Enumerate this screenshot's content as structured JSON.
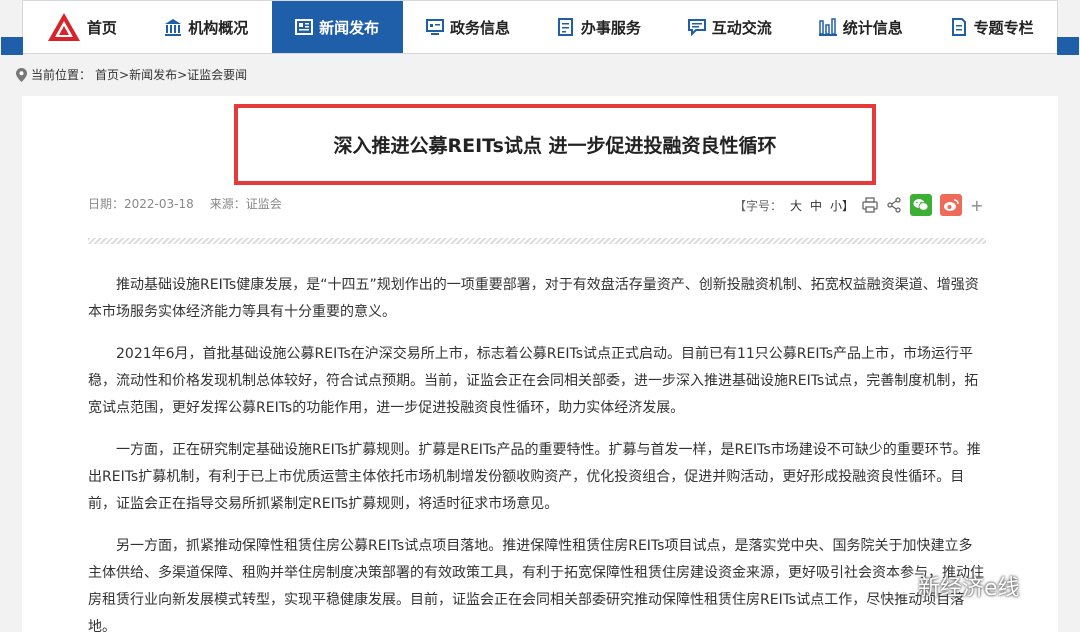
{
  "nav": {
    "items": [
      {
        "label": "首页",
        "icon": "csrc-logo-icon"
      },
      {
        "label": "机构概况",
        "icon": "building-icon"
      },
      {
        "label": "新闻发布",
        "icon": "news-icon",
        "active": true
      },
      {
        "label": "政务信息",
        "icon": "monitor-icon"
      },
      {
        "label": "办事服务",
        "icon": "document-icon"
      },
      {
        "label": "互动交流",
        "icon": "chat-icon"
      },
      {
        "label": "统计信息",
        "icon": "bar-chart-icon"
      },
      {
        "label": "专题专栏",
        "icon": "file-icon"
      }
    ],
    "accent": "#1f5ea8"
  },
  "breadcrumb": {
    "prefix": "当前位置：",
    "path": "首页>新闻发布>证监会要闻"
  },
  "article": {
    "title": "深入推进公募REITs试点 进一步促进投融资良性循环",
    "date": "日期：2022-03-18",
    "source": "来源：证监会",
    "font_size_label": "【字号：",
    "font_large": "大",
    "font_medium": "中",
    "font_small": "小】",
    "paragraphs": [
      "推动基础设施REITs健康发展，是“十四五”规划作出的一项重要部署，对于有效盘活存量资产、创新投融资机制、拓宽权益融资渠道、增强资本市场服务实体经济能力等具有十分重要的意义。",
      "2021年6月，首批基础设施公募REITs在沪深交易所上市，标志着公募REITs试点正式启动。目前已有11只公募REITs产品上市，市场运行平稳，流动性和价格发现机制总体较好，符合试点预期。当前，证监会正在会同相关部委，进一步深入推进基础设施REITs试点，完善制度机制，拓宽试点范围，更好发挥公募REITs的功能作用，进一步促进投融资良性循环，助力实体经济发展。",
      "一方面，正在研究制定基础设施REITs扩募规则。扩募是REITs产品的重要特性。扩募与首发一样，是REITs市场建设不可缺少的重要环节。推出REITs扩募机制，有利于已上市优质运营主体依托市场机制增发份额收购资产，优化投资组合，促进并购活动，更好形成投融资良性循环。目前，证监会正在指导交易所抓紧制定REITs扩募规则，将适时征求市场意见。",
      "另一方面，抓紧推动保障性租赁住房公募REITs试点项目落地。推进保障性租赁住房REITs项目试点，是落实党中央、国务院关于加快建立多主体供给、多渠道保障、租购并举住房制度决策部署的有效政策工具，有利于拓宽保障性租赁住房建设资金来源，更好吸引社会资本参与，推动住房租赁行业向新发展模式转型，实现平稳健康发展。目前，证监会正在会同相关部委研究推动保障性租赁住房REITs试点工作，尽快推动项目落地。"
    ]
  },
  "watermark": {
    "text": "新经济e线"
  }
}
